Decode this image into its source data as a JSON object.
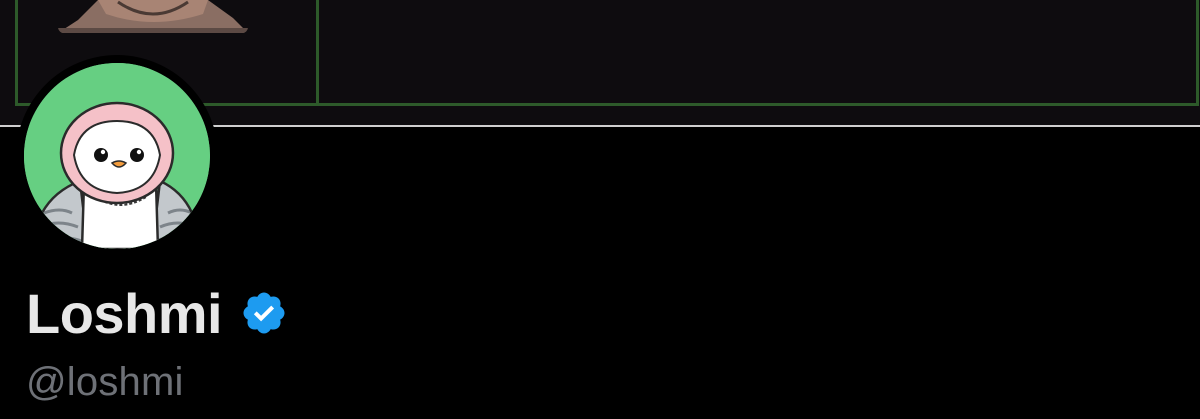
{
  "profile": {
    "display_name": "Loshmi",
    "handle": "@loshmi",
    "verified": true
  },
  "icons": {
    "verified_badge": "verified-checkmark-icon",
    "avatar": "penguin-avatar"
  },
  "colors": {
    "background": "#000000",
    "banner_background": "#0e0c0f",
    "banner_border": "#2d5a2a",
    "avatar_background": "#66cf82",
    "name_text": "#e7e7e7",
    "handle_text": "#6e7177",
    "verified_blue": "#1d9bf0"
  }
}
